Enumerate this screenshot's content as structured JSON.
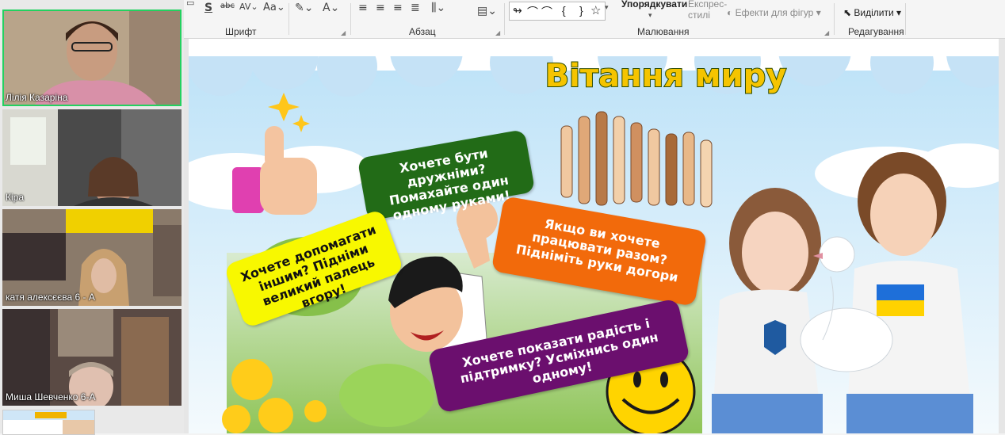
{
  "participants": [
    {
      "name": "Лілія Казаріна",
      "active": true
    },
    {
      "name": "Кіра",
      "active": false
    },
    {
      "name": "катя алексєєва 6 - А",
      "active": false
    },
    {
      "name": "Миша Шевченко 6-А",
      "active": false
    }
  ],
  "ribbon": {
    "groups": {
      "font": "Шрифт",
      "paragraph": "Абзац",
      "drawing": "Малювання",
      "editing": "Редагування"
    },
    "arrange_label": "Упорядкувати",
    "quick_styles_label": "Експрес-\nстилі",
    "shape_effects_label": "Ефекти для фігур",
    "select_label": "Виділити",
    "text_direction_icons": [
      "S",
      "abc",
      "AV",
      "Aa",
      "A"
    ]
  },
  "slide": {
    "title": "Вітання миру",
    "bubble_green": "Хочете бути дружніми? Помахайте один одному руками!",
    "bubble_yellow": "Хочете допомагати іншим? Підніми великий палець вгору!",
    "bubble_orange": "Якщо ви хочете працювати разом? Підніміть руки догори",
    "bubble_purple": "Хочете показати радість і підтримку? Усміхнись один одному!"
  },
  "colors": {
    "green_bubble": "#226b17",
    "yellow_bubble": "#f8f800",
    "orange_bubble": "#f26a0b",
    "purple_bubble": "#6b0f6e",
    "title_fill": "#f5c400",
    "active_speaker": "#23d160"
  }
}
